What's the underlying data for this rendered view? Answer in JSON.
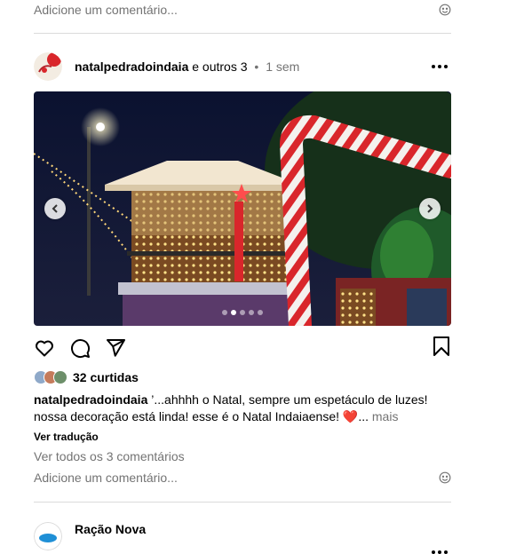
{
  "previous_post": {
    "comment_placeholder": "Adicione um comentário..."
  },
  "post": {
    "username": "natalpedradoindaia",
    "coauthors": "e outros 3",
    "separator": "•",
    "time": "1 sem",
    "likes_count": "32 curtidas",
    "caption_user": "natalpedradoindaia",
    "caption_text": " ’...ahhhh o Natal, sempre um espetáculo de luzes! nossa decoração está linda! esse é o Natal Indaiaense! ❤️... ",
    "caption_more": "mais",
    "translate_label": "Ver tradução",
    "view_comments": "Ver todos os 3 comentários",
    "comment_placeholder": "Adicione um comentário...",
    "carousel": {
      "slide_count": 5,
      "active_slide": 2
    }
  },
  "next_post": {
    "username": "Ração Nova"
  },
  "icons": {
    "like": "heart-icon",
    "comment": "comment-icon",
    "share": "send-icon",
    "save": "bookmark-icon",
    "more": "more-options-icon",
    "emoji": "emoji-icon",
    "prev": "chevron-left-icon",
    "next": "chevron-right-icon"
  },
  "colors": {
    "secondary_text": "#737373",
    "divider": "#dbdbdb",
    "heart_emoji": "#e0245e"
  }
}
